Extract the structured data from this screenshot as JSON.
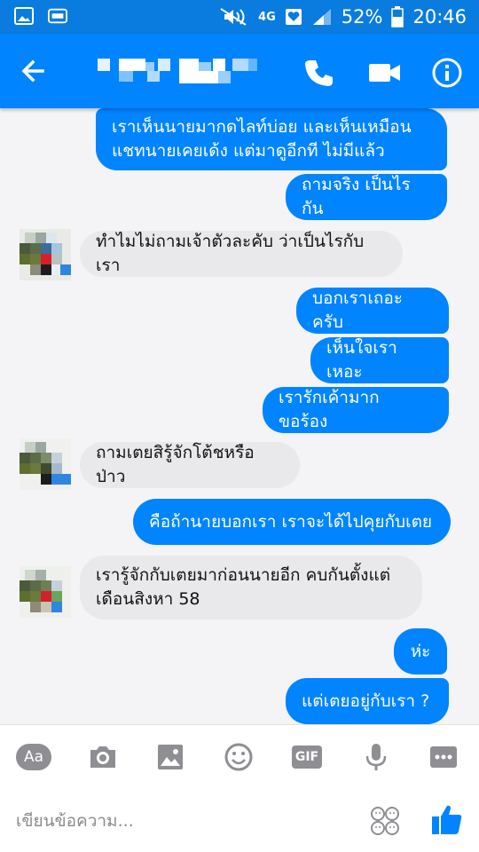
{
  "status_bar": {
    "battery": "52%",
    "time": "20:46",
    "network": "4G",
    "icons": [
      "image-notification-icon",
      "cast-icon",
      "mute-icon",
      "network-4g-icon",
      "heart-notification-icon",
      "signal-icon",
      "battery-icon"
    ]
  },
  "header": {
    "contact_name": "",
    "icons": [
      "back-arrow-icon",
      "phone-icon",
      "video-camera-icon",
      "info-icon"
    ],
    "color": "#0084ff"
  },
  "messages": [
    {
      "side": "out",
      "text": "เราเห็นนายมากดไลท์บ่อย และเห็นเหมือน\nแชทนายเคยเด้ง แต่มาดูอีกที ไม่มีแล้ว"
    },
    {
      "side": "out",
      "text": "ถามจริง เป็นไรกัน"
    },
    {
      "side": "in",
      "text": "ทำไมไม่ถามเจ้าตัวละคับ ว่าเป็นไรกับเรา"
    },
    {
      "side": "out",
      "text": "บอกเราเถอะครับ"
    },
    {
      "side": "out",
      "text": "เห็นใจเราเหอะ"
    },
    {
      "side": "out",
      "text": "เรารักเค้ามาก ขอร้อง"
    },
    {
      "side": "in",
      "text": "ถามเตยสิรู้จักโต้ชหรือป่าว"
    },
    {
      "side": "out",
      "text": "คือถ้านายบอกเรา เราจะได้ไปคุยกับเตย"
    },
    {
      "side": "in",
      "text": "เรารู้จักกับเตยมาก่อนนายอีก คบกันตั้งแต่\nเดือนสิงหา 58"
    },
    {
      "side": "out",
      "text": "ห่ะ"
    },
    {
      "side": "out",
      "text": "แต่เตยอยู่กับเรา ?"
    }
  ],
  "toolbar": {
    "aa_label": "Aa",
    "gif_label": "GIF",
    "icons": [
      "text-format-icon",
      "camera-icon",
      "gallery-icon",
      "emoji-icon",
      "gif-icon",
      "microphone-icon",
      "more-icon"
    ]
  },
  "composer": {
    "placeholder": "เขียนข้อความ...",
    "value": "",
    "icons": [
      "emoji-faces-icon",
      "thumbs-up-icon"
    ]
  },
  "colors": {
    "accent": "#0084ff",
    "status_bar": "#0a7ce0",
    "incoming_bubble": "#e9e9eb",
    "toolbar_icon": "#8e8e93"
  }
}
